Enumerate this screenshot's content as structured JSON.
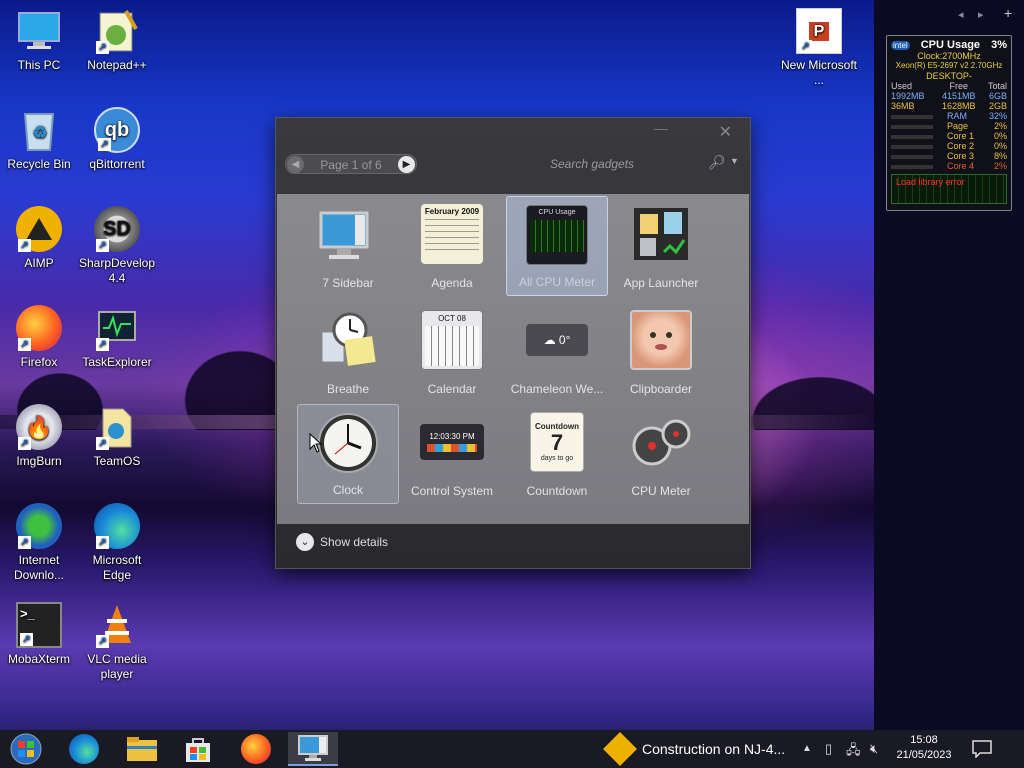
{
  "desktop_icons": [
    {
      "label": "This PC"
    },
    {
      "label": "Notepad++"
    },
    {
      "label": "Recycle Bin"
    },
    {
      "label": "qBittorrent"
    },
    {
      "label": "AIMP"
    },
    {
      "label": "SharpDevelop 4.4"
    },
    {
      "label": "Firefox"
    },
    {
      "label": "TaskExplorer"
    },
    {
      "label": "ImgBurn"
    },
    {
      "label": "TeamOS"
    },
    {
      "label": "Internet Downlo..."
    },
    {
      "label": "Microsoft Edge"
    },
    {
      "label": "MobaXterm"
    },
    {
      "label": "VLC media player"
    },
    {
      "label": "New Microsoft ..."
    }
  ],
  "gadget_window": {
    "page_label": "Page 1 of 6",
    "search_placeholder": "Search gadgets",
    "show_details": "Show details",
    "gadgets": [
      {
        "label": "7 Sidebar"
      },
      {
        "label": "Agenda"
      },
      {
        "label": "All CPU Meter"
      },
      {
        "label": "App Launcher"
      },
      {
        "label": "Breathe"
      },
      {
        "label": "Calendar"
      },
      {
        "label": "Chameleon We..."
      },
      {
        "label": "Clipboarder"
      },
      {
        "label": "Clock"
      },
      {
        "label": "Control System"
      },
      {
        "label": "Countdown"
      },
      {
        "label": "CPU Meter"
      }
    ],
    "thumb_text": {
      "agenda": "February 2009",
      "cpu": "CPU Usage",
      "calendar": "OCT 08",
      "chameleon": "0°",
      "control": "12:03:30 PM",
      "countdown_top": "Countdown",
      "countdown_num": "7",
      "countdown_bottom": "days to go"
    }
  },
  "cpu_widget": {
    "brand": "intel",
    "title": "CPU Usage",
    "percent": "3%",
    "clock": "Clock:2700MHz",
    "model": "Xeon(R) E5-2697 v2 2.70GHz",
    "host": "DESKTOP-",
    "headers": [
      "Used",
      "Free",
      "Total"
    ],
    "rows": [
      [
        "1992MB",
        "4151MB",
        "6GB"
      ],
      [
        "36MB",
        "1628MB",
        "2GB"
      ]
    ],
    "meters": [
      {
        "name": "RAM",
        "value": "32%"
      },
      {
        "name": "Page",
        "value": "2%"
      },
      {
        "name": "Core 1",
        "value": "0%"
      },
      {
        "name": "Core 2",
        "value": "0%"
      },
      {
        "name": "Core 3",
        "value": "8%"
      },
      {
        "name": "Core 4",
        "value": "2%"
      }
    ],
    "error": "Load library error"
  },
  "taskbar": {
    "news": "Construction on NJ-4...",
    "time": "15:08",
    "date": "21/05/2023"
  },
  "colors": {
    "taskbar": "#1a1a24",
    "accent": "#7aa0e0"
  }
}
